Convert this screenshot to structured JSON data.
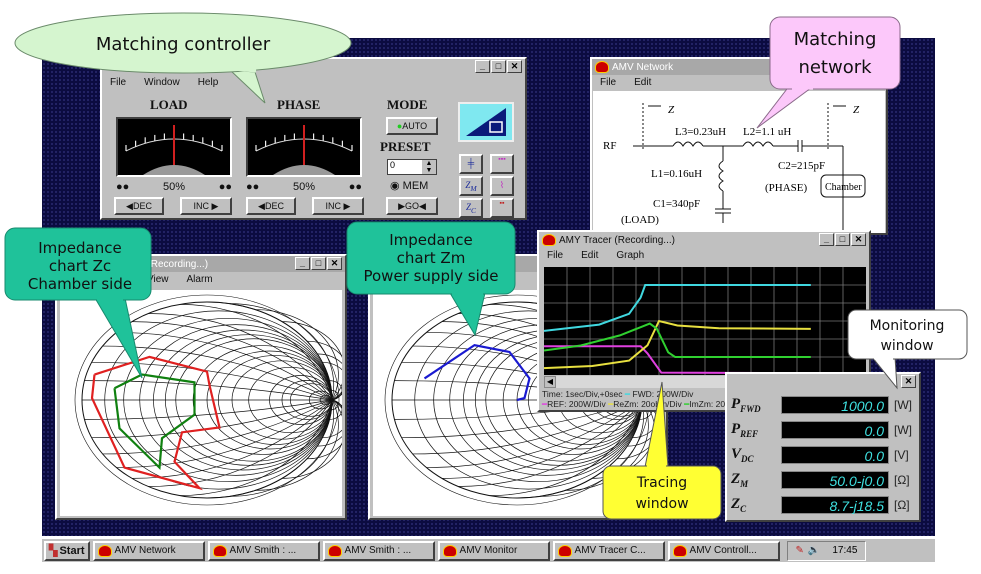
{
  "controller": {
    "menu": [
      "File",
      "Window",
      "Help"
    ],
    "load_label": "LOAD",
    "phase_label": "PHASE",
    "mode_label": "MODE",
    "auto_button": "AUTO",
    "preset_label": "PRESET",
    "preset_value": "0",
    "mem_label": "MEM",
    "go_button": "▶GO◀",
    "load_percent": "50%",
    "phase_percent": "50%",
    "dec_button": "◀DEC",
    "inc_button": "INC ▶",
    "load_level": 0.5,
    "phase_level": 0.5,
    "auto_led_color": "#22cc22"
  },
  "network": {
    "title": "AMV Network",
    "menu": [
      "File",
      "Edit"
    ],
    "zm": "Z",
    "zm_sub": "M",
    "zc": "Z",
    "zc_sub": "C",
    "rf": "RF",
    "l3": "L3=0.23uH",
    "l2": "L2=1.1 uH",
    "l1": "L1=0.16uH",
    "c1": "C1=340pF",
    "c2": "C2=215pF",
    "phase": "(PHASE)",
    "load": "(LOAD)",
    "chamber": "Chamber"
  },
  "smith_zc": {
    "title": ": Zc (Recording...)",
    "menu": [
      "View",
      "Alarm"
    ],
    "traces": [
      {
        "color": "#e02020",
        "points": [
          [
            -0.9,
            0.26
          ],
          [
            -0.46,
            0.44
          ],
          [
            0,
            0.29
          ],
          [
            0.02,
            0.15
          ],
          [
            0.1,
            -0.28
          ],
          [
            -0.2,
            -0.33
          ],
          [
            -0.26,
            -0.63
          ],
          [
            -0.06,
            -0.9
          ],
          [
            -0.66,
            -0.69
          ],
          [
            -0.92,
            0.02
          ],
          [
            -0.9,
            0.26
          ]
        ]
      },
      {
        "color": "#108010",
        "points": [
          [
            -0.74,
            0.12
          ],
          [
            -0.52,
            0.26
          ],
          [
            -0.1,
            0.18
          ],
          [
            -0.1,
            -0.15
          ],
          [
            -0.36,
            -0.39
          ],
          [
            -0.38,
            -0.69
          ],
          [
            -0.7,
            -0.29
          ],
          [
            -0.74,
            0.12
          ]
        ]
      }
    ]
  },
  "smith_zm": {
    "traces": [
      {
        "color": "#1a1ad0",
        "points": [
          [
            -0.74,
            0.22
          ],
          [
            -0.34,
            0.56
          ],
          [
            -0.06,
            0.49
          ],
          [
            0.1,
            0.22
          ],
          [
            0.06,
            0.02
          ],
          [
            0,
            0
          ]
        ]
      }
    ]
  },
  "tracer": {
    "title": "AMY Tracer (Recording...)",
    "menu": [
      "File",
      "Edit",
      "Graph"
    ],
    "legend_time": "Time: 1sec/Div,+0sec",
    "legend_fwd": "FWD: 200W/Div",
    "legend_ref": "REF: 200W/Div",
    "legend_rezm": "ReZm: 20ohm/Div",
    "legend_imzm": "ImZm: 20ohm",
    "x_divisions": 14,
    "y_divisions": 6,
    "series": [
      {
        "name": "FWD",
        "color": "#40d8e0",
        "points": [
          [
            0,
            2.45
          ],
          [
            2.4,
            2.8
          ],
          [
            3.7,
            3.4
          ],
          [
            4.2,
            4.3
          ],
          [
            4.4,
            5.0
          ],
          [
            11.6,
            5.0
          ]
        ]
      },
      {
        "name": "REF",
        "color": "#e040e0",
        "points": [
          [
            0,
            1.6
          ],
          [
            4.2,
            1.6
          ],
          [
            4.5,
            1.2
          ],
          [
            5.1,
            0.13
          ],
          [
            11.6,
            0.1
          ]
        ]
      },
      {
        "name": "ReZm",
        "color": "#e8e040",
        "points": [
          [
            0,
            0.38
          ],
          [
            2.1,
            0.5
          ],
          [
            3.7,
            0.8
          ],
          [
            4.5,
            1.65
          ],
          [
            5.0,
            3.0
          ],
          [
            5.8,
            2.75
          ],
          [
            7.6,
            2.6
          ],
          [
            11.6,
            2.56
          ]
        ]
      },
      {
        "name": "ImZm",
        "color": "#30d030",
        "points": [
          [
            0,
            1.36
          ],
          [
            1.6,
            1.64
          ],
          [
            3.3,
            2.2
          ],
          [
            4.6,
            2.86
          ],
          [
            4.9,
            2.58
          ],
          [
            5.4,
            1.26
          ],
          [
            5.7,
            1.0
          ],
          [
            11.6,
            1.0
          ]
        ]
      }
    ]
  },
  "monitor": {
    "rows": [
      {
        "name": "P",
        "sub": "FWD",
        "value": "1000.0",
        "unit": "[W]"
      },
      {
        "name": "P",
        "sub": "REF",
        "value": "0.0",
        "unit": "[W]"
      },
      {
        "name": "V",
        "sub": "DC",
        "value": "0.0",
        "unit": "[V]"
      },
      {
        "name": "Z",
        "sub": "M",
        "value": "50.0-j0.0",
        "unit": "[Ω]"
      },
      {
        "name": "Z",
        "sub": "C",
        "value": "8.7-j18.5",
        "unit": "[Ω]"
      }
    ]
  },
  "taskbar": {
    "start": "Start",
    "tasks": [
      "AMV Network",
      "AMV Smith : ...",
      "AMV Smith : ...",
      "AMV Monitor",
      "AMV Tracer C...",
      "AMV Controll..."
    ],
    "clock": "17:45"
  },
  "callouts": {
    "controller": "Matching controller",
    "network_1": "Matching",
    "network_2": "network",
    "zc_1": "Impedance",
    "zc_2": "chart Zc",
    "zc_3": "Chamber side",
    "zm_1": "Impedance",
    "zm_2": "chart Zm",
    "zm_3": "Power supply side",
    "monitor_1": "Monitoring",
    "monitor_2": "window",
    "tracer_1": "Tracing",
    "tracer_2": "window"
  }
}
